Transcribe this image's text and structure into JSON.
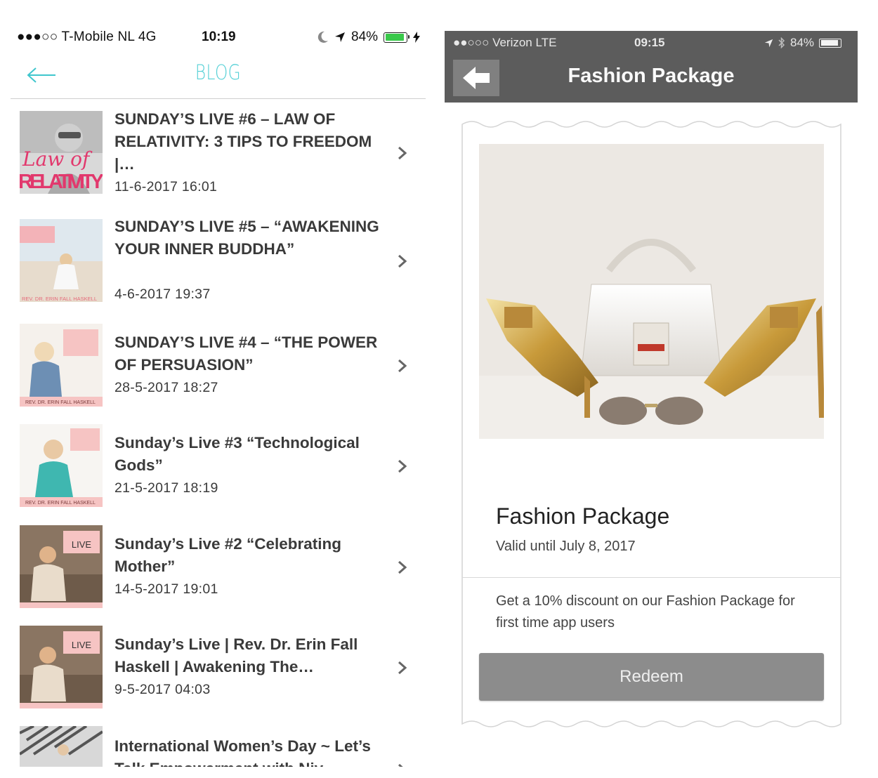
{
  "left_app": {
    "status_bar": {
      "carrier": "●●●○○ T-Mobile NL   4G",
      "time": "10:19",
      "battery": "84%"
    },
    "nav": {
      "title": "BLOG",
      "back_icon": "arrow-left-icon"
    },
    "posts": [
      {
        "title": "SUNDAY’S LIVE #6 –  LAW OF RELATIVITY: 3 TIPS TO FREEDOM |…",
        "date": "11-6-2017 16:01",
        "thumb_text": "Law of RELATIVITY"
      },
      {
        "title": "SUNDAY’S LIVE #5 – “AWAKENING YOUR INNER BUDDHA”",
        "date": "4-6-2017 19:37",
        "thumb_text": "REV. DR. ERIN FALL HASKELL"
      },
      {
        "title": "SUNDAY’S LIVE #4 – “THE POWER OF PERSUASION”",
        "date": "28-5-2017 18:27",
        "thumb_text": "REV. DR. ERIN FALL HASKELL"
      },
      {
        "title": "Sunday’s Live #3 “Technological Gods”",
        "date": "21-5-2017 18:19",
        "thumb_text": "REV. DR. ERIN FALL HASKELL"
      },
      {
        "title": "Sunday’s Live #2 “Celebrating Mother”",
        "date": "14-5-2017 19:01",
        "thumb_text": "LIVE"
      },
      {
        "title": "Sunday’s Live | Rev. Dr. Erin Fall Haskell | Awakening The…",
        "date": "9-5-2017 04:03",
        "thumb_text": "LIVE"
      },
      {
        "title": "International Women’s Day ~ Let’s Talk Empowerment with Niv",
        "date": "",
        "thumb_text": ""
      }
    ]
  },
  "right_app": {
    "status_bar": {
      "carrier": "●●○○○ Verizon  LTE",
      "time": "09:15",
      "battery": "84%"
    },
    "nav": {
      "title": "Fashion Package",
      "back_icon": "arrow-left-icon"
    },
    "offer": {
      "name": "Fashion Package",
      "valid": "Valid until July 8, 2017",
      "description": "Get a 10% discount on our Fashion Package for first time app users",
      "button": "Redeem"
    }
  },
  "colors": {
    "accent": "#55d0d6",
    "right_header": "#5c5c5c",
    "redeem_button": "#8c8c8c",
    "battery_green": "#39c94a"
  }
}
